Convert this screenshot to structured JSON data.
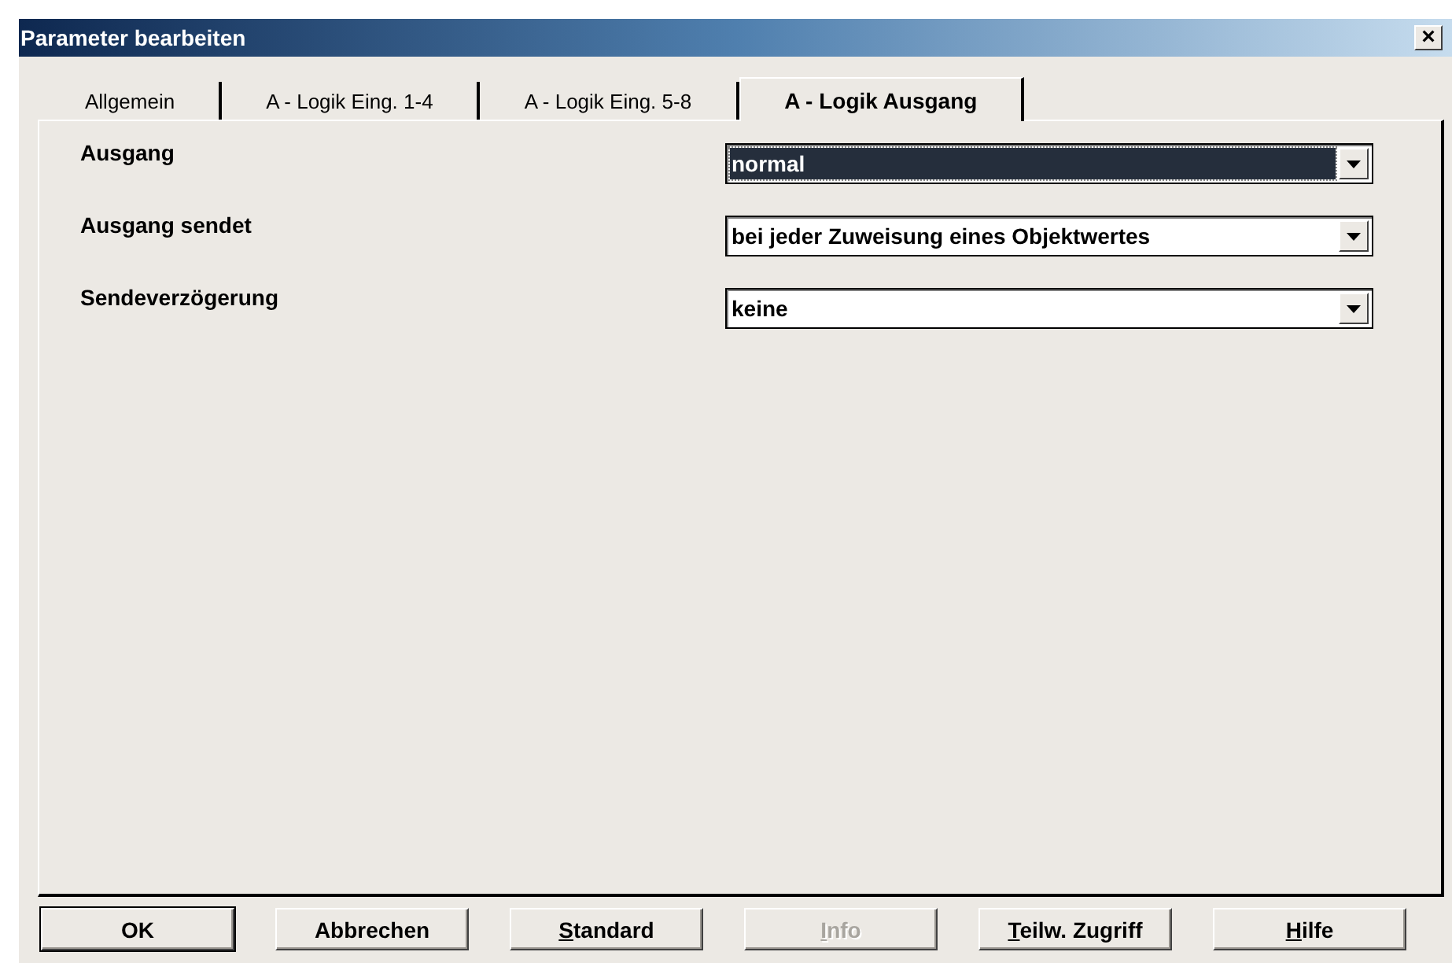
{
  "window": {
    "title": "Parameter bearbeiten",
    "close": "×"
  },
  "tabs": [
    {
      "label": "Allgemein",
      "selected": false
    },
    {
      "label": "A - Logik Eing. 1-4",
      "selected": false
    },
    {
      "label": "A - Logik Eing. 5-8",
      "selected": false
    },
    {
      "label": "A - Logik Ausgang",
      "selected": true
    }
  ],
  "parameters": [
    {
      "label": "Ausgang",
      "value": "normal",
      "focused": true
    },
    {
      "label": "Ausgang sendet",
      "value": "bei jeder Zuweisung eines Objektwertes",
      "focused": false
    },
    {
      "label": "Sendeverzögerung",
      "value": "keine",
      "focused": false
    }
  ],
  "buttons": [
    {
      "label": "OK",
      "default": true,
      "disabled": false
    },
    {
      "label": "Abbrechen",
      "default": false,
      "disabled": false
    },
    {
      "label": "Standard",
      "underline_first": true,
      "default": false,
      "disabled": false
    },
    {
      "label": "Info",
      "underline_first": true,
      "default": false,
      "disabled": true
    },
    {
      "label": "Teilw. Zugriff",
      "underline_first": true,
      "default": false,
      "disabled": false
    },
    {
      "label": "Hilfe",
      "underline_first": true,
      "default": false,
      "disabled": false
    }
  ]
}
